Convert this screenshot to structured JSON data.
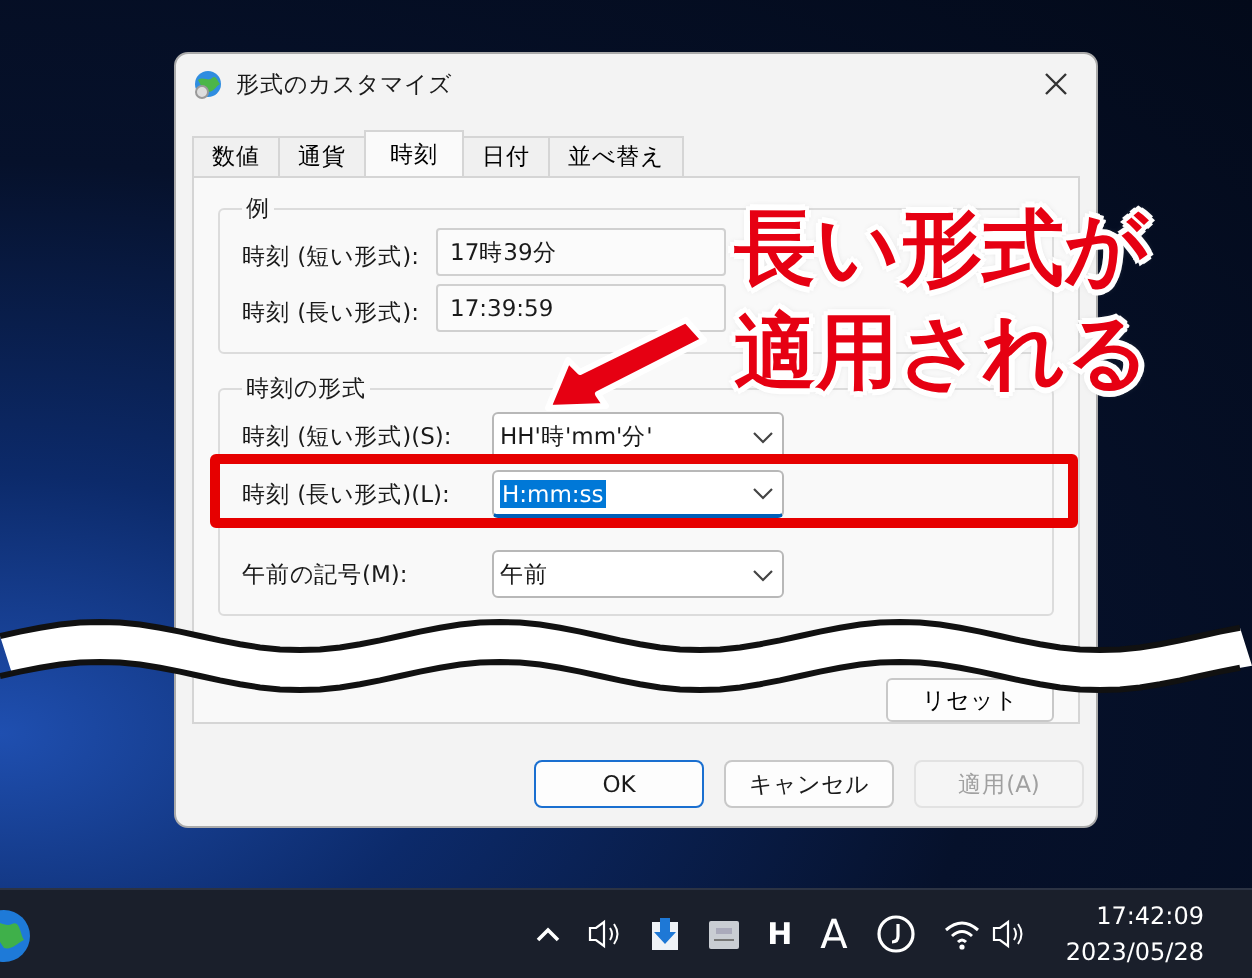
{
  "window": {
    "title": "形式のカスタマイズ"
  },
  "tabs": [
    {
      "label": "数値",
      "selected": false
    },
    {
      "label": "通貨",
      "selected": false
    },
    {
      "label": "時刻",
      "selected": true
    },
    {
      "label": "日付",
      "selected": false
    },
    {
      "label": "並べ替え",
      "selected": false
    }
  ],
  "example": {
    "title": "例",
    "rows": [
      {
        "label": "時刻 (短い形式):",
        "value": "17時39分"
      },
      {
        "label": "時刻 (長い形式):",
        "value": "17:39:59"
      }
    ]
  },
  "format": {
    "title": "時刻の形式",
    "rows": [
      {
        "label": "時刻 (短い形式)(S):",
        "value": "HH'時'mm'分'",
        "text_selected": false,
        "annotated": false
      },
      {
        "label": "時刻 (長い形式)(L):",
        "value": "H:mm:ss",
        "text_selected": true,
        "annotated": true
      },
      {
        "label": "午前の記号(M):",
        "value": "午前",
        "text_selected": false,
        "annotated": false
      }
    ]
  },
  "reset_button": {
    "label": "リセット"
  },
  "buttons": [
    {
      "label": "OK",
      "default": true,
      "disabled": false
    },
    {
      "label": "キャンセル",
      "default": false,
      "disabled": false
    },
    {
      "label": "適用(A)",
      "default": false,
      "disabled": true
    }
  ],
  "annotation": {
    "lines": [
      "長い形式が",
      "適用される"
    ]
  },
  "taskbar": {
    "tray": [
      {
        "kind": "chevron"
      },
      {
        "kind": "speaker"
      },
      {
        "kind": "download"
      },
      {
        "kind": "keyboard"
      },
      {
        "kind": "text",
        "text": "H"
      },
      {
        "kind": "text",
        "text": "A"
      },
      {
        "kind": "clockface"
      },
      {
        "kind": "wifi"
      },
      {
        "kind": "speaker"
      }
    ],
    "time": "17:42:09",
    "date": "2023/05/28"
  }
}
